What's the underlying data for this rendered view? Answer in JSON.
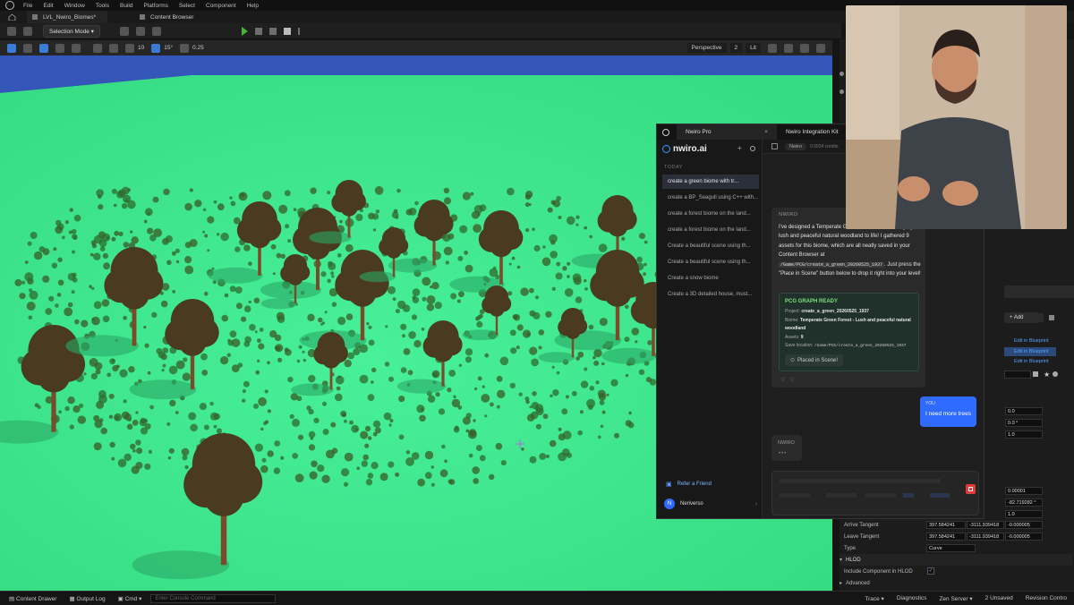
{
  "menu": [
    "File",
    "Edit",
    "Window",
    "Tools",
    "Build",
    "Platforms",
    "Select",
    "Component",
    "Help"
  ],
  "level_tab": "LVL_Nwiro_Biomes*",
  "content_browser_tab": "Content Browser",
  "toolbar": {
    "selection_mode": "Selection Mode"
  },
  "viewport_toolbar": {
    "grid_snap": "10",
    "rotation_snap": "15°",
    "scale_snap": "0.25",
    "perspective": "Perspective",
    "lit": "Lit",
    "camera_speed": "2"
  },
  "plugin": {
    "tab_active": "Nwiro Pro",
    "tab_other": "Nwiro Integration Kit",
    "logo_text": "nwiro.ai",
    "header_badge": "Nwiro",
    "credits": "0.0034 credits",
    "section_label": "TODAY",
    "history": [
      "create a green biome with tr...",
      "create a BP_Seagull using C++ with...",
      "create a forest biome on the land...",
      "create a forest biome on the land...",
      "Create a beautiful scene using th...",
      "Create a beautiful scene using th...",
      "Create a snow biome",
      "Create a 3D detailed house, must..."
    ],
    "refer": "Refer a Friend",
    "user_initial": "N",
    "user_name": "Neriverso",
    "bot_label": "NWIRO",
    "bot_message_1": "I've designed a Temperate Green Forest biome, bringing a lush and peaceful natural woodland to life! I gathered 9 assets for this biome, which are all neatly saved in your Content Browser at",
    "bot_path": "/Game/PCG/create_a_green_20260525_1937",
    "bot_message_2": ". Just press the \"Place in Scene\" button below to drop it right into your level!",
    "card_title": "PCG GRAPH READY",
    "card_project_label": "Project:",
    "card_project": "create_a_green_20260525_1937",
    "card_biome_label": "Biome:",
    "card_biome": "Temperate Green Forest - Lush and peaceful natural woodland",
    "card_assets_label": "Assets:",
    "card_assets": "9",
    "card_save_label": "Save location:",
    "card_save": "/Game/PCG/create_a_green_20260525_1937",
    "placed_button": "Placed in Scene!",
    "user_label": "YOU",
    "user_message": "I need more trees",
    "bot_label_2": "NWIRO"
  },
  "details": {
    "add_button": "Add",
    "edit_bp": [
      "Edit in Blueprint",
      "Edit in Blueprint",
      "Edit in Blueprint"
    ],
    "values": [
      "0.0",
      "0.0 °",
      "1.0",
      "0.00001",
      "-82.719282 °",
      "1.0"
    ],
    "arrive_tangent_label": "Arrive Tangent",
    "arrive_tangent": [
      "397.584241",
      "-3111.939418",
      "-0.000005"
    ],
    "leave_tangent_label": "Leave Tangent",
    "leave_tangent": [
      "397.584241",
      "-3111.939418",
      "-0.000005"
    ],
    "type_label": "Type",
    "type_value": "Curve",
    "hlod_section": "HLOD",
    "include_hlod": "Include Component in HLOD",
    "advanced": "Advanced"
  },
  "status_bar": {
    "content_drawer": "Content Drawer",
    "output_log": "Output Log",
    "cmd": "Cmd",
    "console_placeholder": "Enter Console Command",
    "trace": "Trace",
    "diagnostics": "Diagnostics",
    "zen_server": "Zen Server",
    "unsaved": "2 Unsaved",
    "revision_control": "Revision Contro"
  },
  "colors": {
    "ground_green": "#3ee88e",
    "sky_blue": "#3456b8",
    "accent_blue": "#2f6bff",
    "card_green": "#7be07b",
    "stop_red": "#e03a3a"
  }
}
